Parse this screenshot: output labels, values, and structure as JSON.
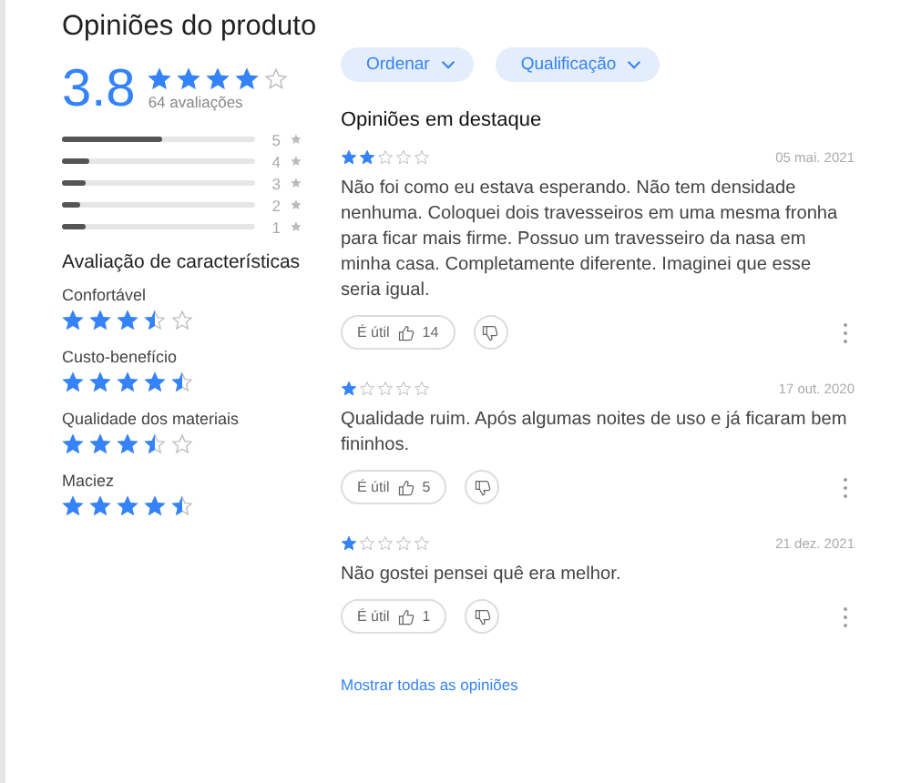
{
  "title": "Opiniões do produto",
  "summary": {
    "average": "3.8",
    "stars": 3.8,
    "count": "64 avaliações"
  },
  "distribution": [
    {
      "label": "5",
      "level": 0.52
    },
    {
      "label": "4",
      "level": 0.14
    },
    {
      "label": "3",
      "level": 0.12
    },
    {
      "label": "2",
      "level": 0.09
    },
    {
      "label": "1",
      "level": 0.12
    }
  ],
  "characteristics_title": "Avaliação de características",
  "characteristics": [
    {
      "name": "Confortável",
      "stars": 3.5
    },
    {
      "name": "Custo-benefício",
      "stars": 4.5
    },
    {
      "name": "Qualidade dos materiais",
      "stars": 3.5
    },
    {
      "name": "Maciez",
      "stars": 4.5
    }
  ],
  "filters": [
    "Ordenar",
    "Qualificação"
  ],
  "featured_title": "Opiniões em destaque",
  "reviews": [
    {
      "stars": 2,
      "date": "05 mai. 2021",
      "text": "Não foi como eu estava esperando. Não tem densidade nenhuma. Coloquei dois travesseiros em uma mesma fronha para ficar mais firme. Possuo um travesseiro da nasa em minha casa. Completamente diferente. Imaginei que esse seria igual.",
      "helpful_label": "É útil",
      "helpful_count": "14"
    },
    {
      "stars": 1,
      "date": "17 out. 2020",
      "text": "Qualidade ruim. Após algumas noites de uso e já ficaram bem fininhos.",
      "helpful_label": "É útil",
      "helpful_count": "5"
    },
    {
      "stars": 1,
      "date": "21 dez. 2021",
      "text": "Não gostei pensei quê era melhor.",
      "helpful_label": "É útil",
      "helpful_count": "1"
    }
  ],
  "show_all": "Mostrar todas as opiniões"
}
